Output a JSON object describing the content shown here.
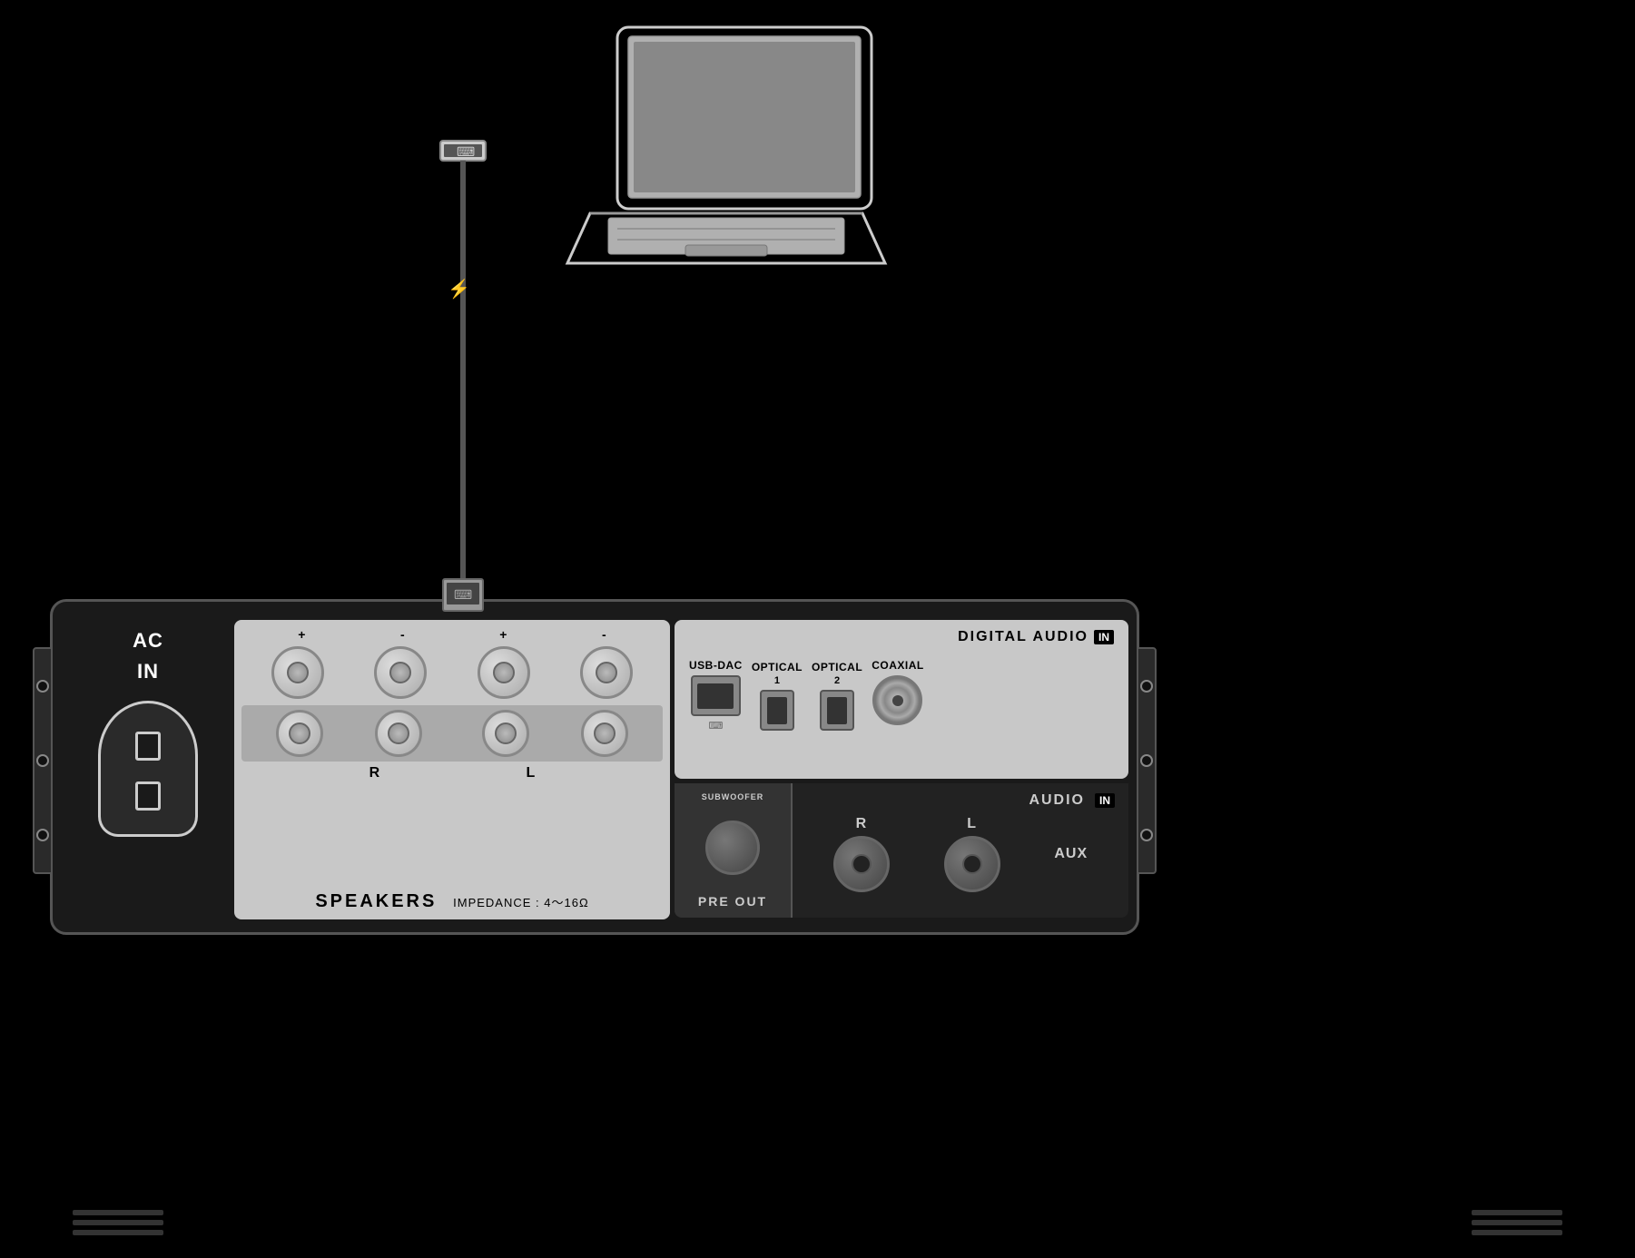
{
  "background": "#000000",
  "laptop": {
    "alt": "Laptop computer illustration"
  },
  "cable": {
    "usb_symbol": "⌨",
    "description": "USB cable connecting laptop to amplifier"
  },
  "amp": {
    "ac_in": {
      "label_line1": "AC",
      "label_line2": "IN"
    },
    "speakers": {
      "title": "SPEAKERS",
      "impedance": "IMPEDANCE : 4～16Ω",
      "terminals": [
        {
          "polarity": "+",
          "channel": ""
        },
        {
          "polarity": "-",
          "channel": ""
        },
        {
          "polarity": "+",
          "channel": ""
        },
        {
          "polarity": "-",
          "channel": ""
        },
        {
          "polarity": "+",
          "channel": "R"
        },
        {
          "polarity": "-",
          "channel": ""
        },
        {
          "polarity": "+",
          "channel": "L"
        },
        {
          "polarity": "-",
          "channel": ""
        }
      ]
    },
    "digital_audio": {
      "section_label": "DIGITAL AUDIO",
      "in_badge": "IN",
      "ports": [
        {
          "label": "USB-DAC",
          "type": "usb"
        },
        {
          "label": "OPTICAL",
          "sublabel": "1",
          "type": "optical"
        },
        {
          "label": "OPTICAL",
          "sublabel": "2",
          "type": "optical"
        },
        {
          "label": "COAXIAL",
          "type": "coaxial"
        }
      ]
    },
    "pre_out": {
      "sub_label": "SUBWOOFER",
      "footer_label": "PRE OUT"
    },
    "audio_in": {
      "r_label": "R",
      "l_label": "L",
      "aux_label": "AUX",
      "footer_label": "AUDIO",
      "in_badge": "IN"
    }
  },
  "bottom_decorations": [
    {
      "lines": 3
    },
    {
      "lines": 3
    }
  ]
}
